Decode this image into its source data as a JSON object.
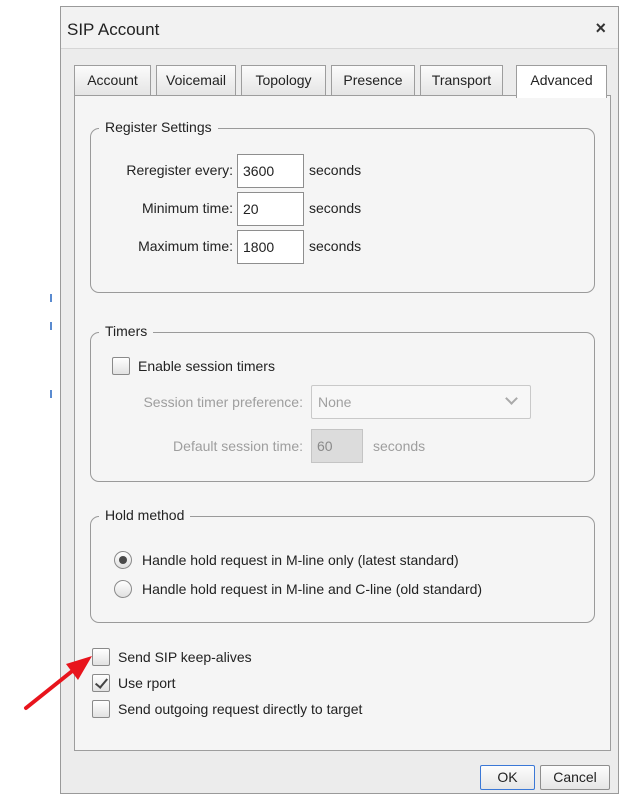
{
  "dialog": {
    "title": "SIP Account",
    "close_symbol": "×"
  },
  "tabs": [
    {
      "label": "Account",
      "active": false
    },
    {
      "label": "Voicemail",
      "active": false
    },
    {
      "label": "Topology",
      "active": false
    },
    {
      "label": "Presence",
      "active": false
    },
    {
      "label": "Transport",
      "active": false
    },
    {
      "label": "Advanced",
      "active": true
    }
  ],
  "register_settings": {
    "legend": "Register Settings",
    "rows": [
      {
        "label": "Reregister every:",
        "value": "3600",
        "unit": "seconds"
      },
      {
        "label": "Minimum time:",
        "value": "20",
        "unit": "seconds"
      },
      {
        "label": "Maximum time:",
        "value": "1800",
        "unit": "seconds"
      }
    ]
  },
  "timers": {
    "legend": "Timers",
    "enable_label": "Enable session timers",
    "enable_checked": false,
    "preference_label": "Session timer preference:",
    "preference_value": "None",
    "default_time_label": "Default session time:",
    "default_time_value": "60",
    "default_time_unit": "seconds"
  },
  "hold_method": {
    "legend": "Hold method",
    "options": [
      {
        "label": "Handle hold request in M-line only (latest standard)",
        "selected": true
      },
      {
        "label": "Handle hold request in M-line and C-line (old standard)",
        "selected": false
      }
    ]
  },
  "checkboxes": [
    {
      "label": "Send SIP keep-alives",
      "checked": false
    },
    {
      "label": "Use rport",
      "checked": true
    },
    {
      "label": "Send outgoing request directly to target",
      "checked": false
    }
  ],
  "buttons": {
    "ok": "OK",
    "cancel": "Cancel"
  },
  "colors": {
    "annotation_arrow": "#e8141c",
    "default_button_border": "#3b78d6"
  }
}
